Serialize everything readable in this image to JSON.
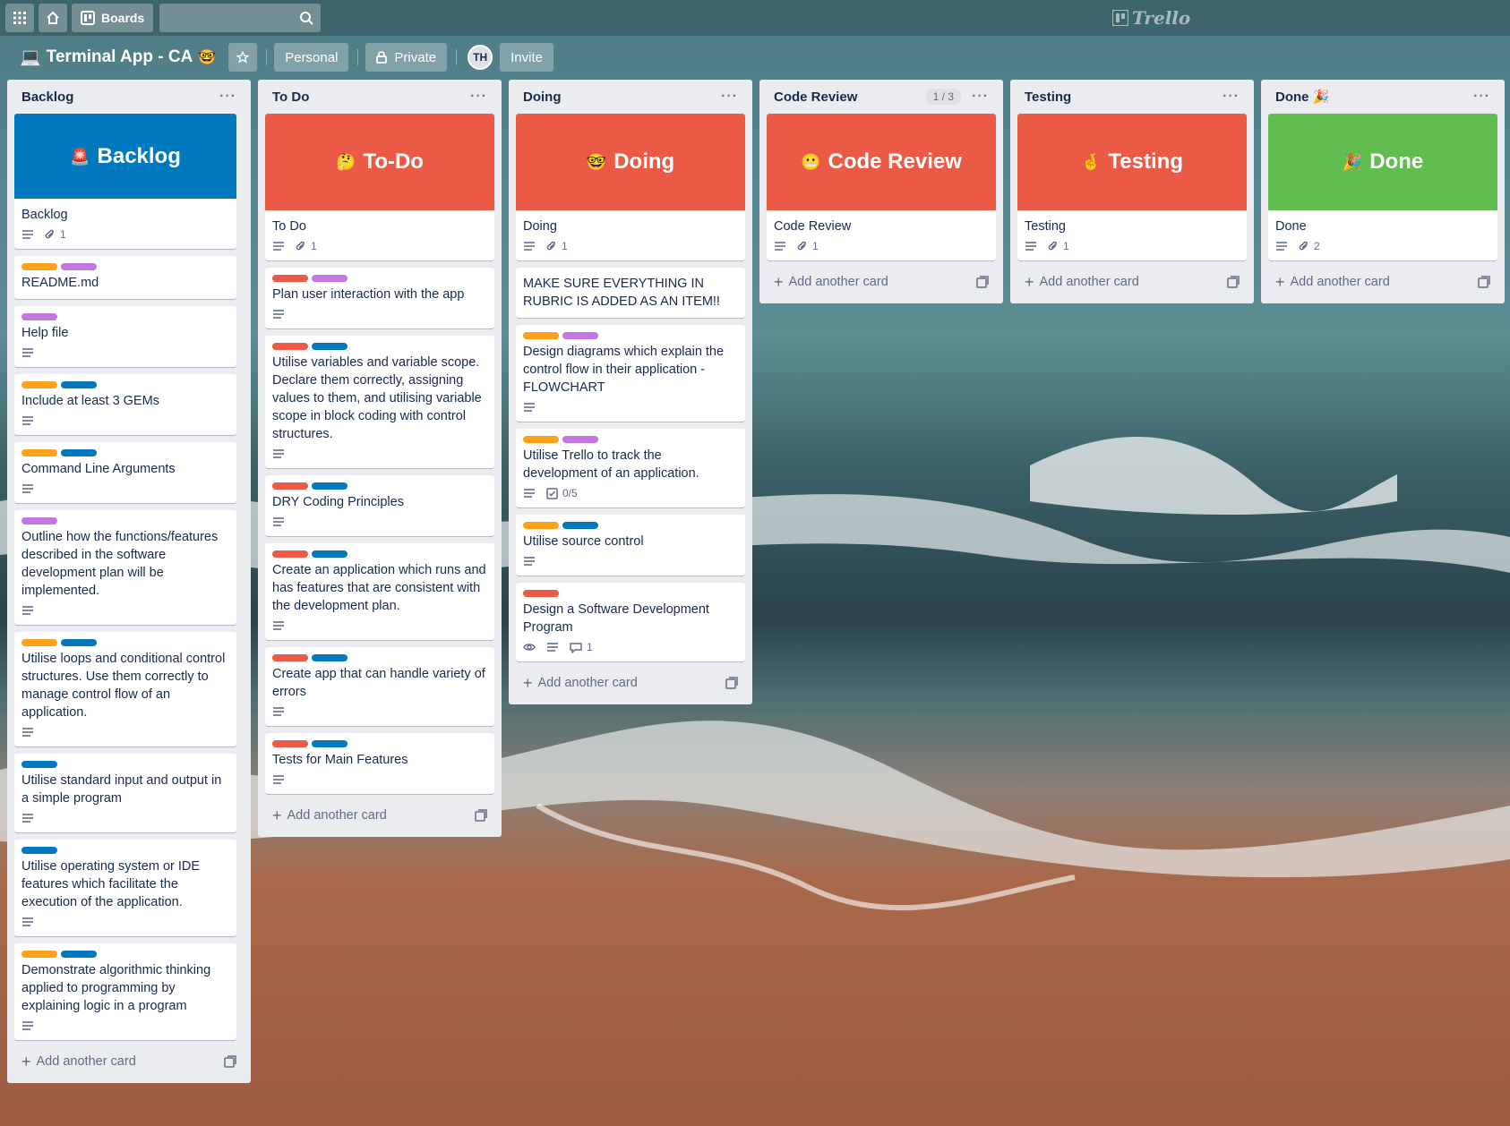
{
  "topbar": {
    "boards_label": "Boards",
    "logo_text": "Trello",
    "icons": [
      "apps-grid-icon",
      "home-icon",
      "boards-icon",
      "search-icon"
    ]
  },
  "board": {
    "emoji": "💻",
    "title": "Terminal App - CA",
    "title_emoji": "🤓",
    "team_label": "Personal",
    "visibility_label": "Private",
    "member_initials": "TH",
    "invite_label": "Invite"
  },
  "colors": {
    "orange": "#ff9f1a",
    "purple": "#c377e0",
    "blue": "#0079bf",
    "red": "#eb5a46",
    "green": "#61bd4f"
  },
  "lists": [
    {
      "title": "Backlog",
      "cover": {
        "emoji": "🚨",
        "text": "Backlog",
        "color": "#0079bf"
      },
      "cover_card": {
        "text": "Backlog",
        "attachments": "1"
      },
      "cards": [
        {
          "labels": [
            "orange",
            "purple"
          ],
          "text": "README.md",
          "description": false
        },
        {
          "labels": [
            "purple"
          ],
          "text": "Help file",
          "description": true
        },
        {
          "labels": [
            "orange",
            "blue"
          ],
          "text": "Include at least 3 GEMs",
          "description": true
        },
        {
          "labels": [
            "orange",
            "blue"
          ],
          "text": "Command Line Arguments",
          "description": true
        },
        {
          "labels": [
            "purple"
          ],
          "text": "Outline how the functions/features described in the software development plan will be implemented.",
          "description": true
        },
        {
          "labels": [
            "orange",
            "blue"
          ],
          "text": "Utilise loops and conditional control structures. Use them correctly to manage control flow of an application.",
          "description": true
        },
        {
          "labels": [
            "blue"
          ],
          "text": "Utilise standard input and output in a simple program",
          "description": true
        },
        {
          "labels": [
            "blue"
          ],
          "text": "Utilise operating system or IDE features which facilitate the execution of the application.",
          "description": true
        },
        {
          "labels": [
            "orange",
            "blue"
          ],
          "text": "Demonstrate algorithmic thinking applied to programming by explaining logic in a program",
          "description": true
        }
      ],
      "add_label": "Add another card"
    },
    {
      "title": "To Do",
      "cover": {
        "emoji": "🤔",
        "text": "To-Do",
        "color": "#eb5a46"
      },
      "cover_card": {
        "text": "To Do",
        "attachments": "1"
      },
      "cards": [
        {
          "labels": [
            "red",
            "purple"
          ],
          "text": "Plan user interaction with the app",
          "description": true
        },
        {
          "labels": [
            "red",
            "blue"
          ],
          "text": "Utilise variables and variable scope. Declare them correctly, assigning values to them, and utilising variable scope in block coding with control structures.",
          "description": true
        },
        {
          "labels": [
            "red",
            "blue"
          ],
          "text": "DRY Coding Principles",
          "description": true
        },
        {
          "labels": [
            "red",
            "blue"
          ],
          "text": "Create an application which runs and has features that are consistent with the development plan.",
          "description": true
        },
        {
          "labels": [
            "red",
            "blue"
          ],
          "text": "Create app that can handle variety of errors",
          "description": true
        },
        {
          "labels": [
            "red",
            "blue"
          ],
          "text": "Tests for Main Features",
          "description": true
        }
      ],
      "add_label": "Add another card"
    },
    {
      "title": "Doing",
      "cover": {
        "emoji": "🤓",
        "text": "Doing",
        "color": "#eb5a46"
      },
      "cover_card": {
        "text": "Doing",
        "attachments": "1"
      },
      "cards": [
        {
          "labels": [],
          "text": "MAKE SURE EVERYTHING IN RUBRIC IS ADDED AS AN ITEM!!",
          "description": false
        },
        {
          "labels": [
            "orange",
            "purple"
          ],
          "text": "Design diagrams which explain the control flow in their application - FLOWCHART",
          "description": true
        },
        {
          "labels": [
            "orange",
            "purple"
          ],
          "text": "Utilise Trello to track the development of an application.",
          "description": true,
          "checklist": "0/5"
        },
        {
          "labels": [
            "orange",
            "blue"
          ],
          "text": "Utilise source control",
          "description": true
        },
        {
          "labels": [
            "red"
          ],
          "text": "Design a Software Development Program",
          "description": true,
          "watching": true,
          "comments": "1"
        }
      ],
      "add_label": "Add another card"
    },
    {
      "title": "Code Review",
      "counter": "1 / 3",
      "cover": {
        "emoji": "😬",
        "text": "Code Review",
        "color": "#eb5a46"
      },
      "cover_card": {
        "text": "Code Review",
        "attachments": "1"
      },
      "cards": [],
      "add_label": "Add another card"
    },
    {
      "title": "Testing",
      "cover": {
        "emoji": "🤞",
        "text": "Testing",
        "color": "#eb5a46"
      },
      "cover_card": {
        "text": "Testing",
        "attachments": "1"
      },
      "cards": [],
      "add_label": "Add another card"
    },
    {
      "title": "Done",
      "title_emoji": "🎉",
      "cover": {
        "emoji": "🎉",
        "text": "Done",
        "color": "#61bd4f"
      },
      "cover_card": {
        "text": "Done",
        "attachments": "2"
      },
      "cards": [],
      "add_label": "Add another card"
    }
  ]
}
